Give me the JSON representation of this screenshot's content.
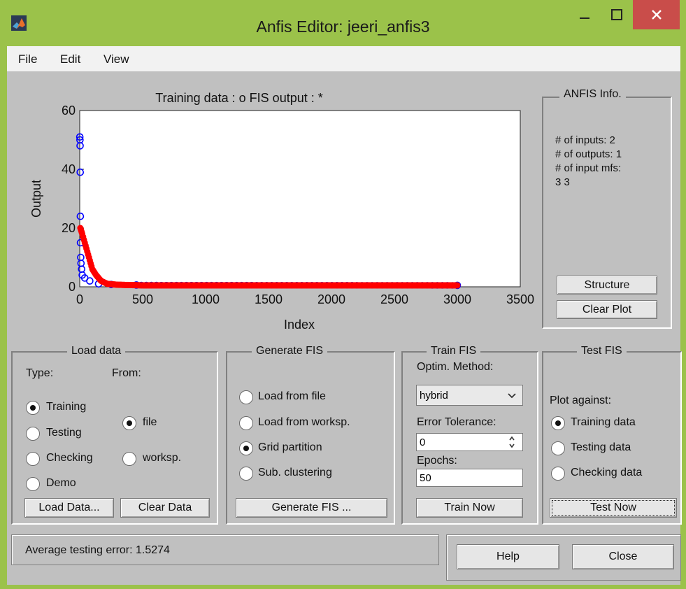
{
  "window": {
    "title": "Anfis Editor: jeeri_anfis3"
  },
  "menu": {
    "file": "File",
    "edit": "Edit",
    "view": "View"
  },
  "plot": {
    "title": "Training data : o   FIS output : *",
    "xlabel": "Index",
    "ylabel": "Output",
    "xticks": [
      "0",
      "500",
      "1000",
      "1500",
      "2000",
      "2500",
      "3000",
      "3500"
    ],
    "yticks": [
      "0",
      "20",
      "40",
      "60"
    ]
  },
  "chart_data": {
    "type": "scatter",
    "title": "Training data : o   FIS output : *",
    "xlabel": "Index",
    "ylabel": "Output",
    "xlim": [
      0,
      3500
    ],
    "ylim": [
      0,
      60
    ],
    "series": [
      {
        "name": "Training data",
        "marker": "o",
        "color": "#0000ff",
        "points": [
          [
            1,
            51
          ],
          [
            2,
            50
          ],
          [
            3,
            48
          ],
          [
            4,
            39
          ],
          [
            5,
            24
          ],
          [
            6,
            15
          ],
          [
            8,
            10
          ],
          [
            10,
            8
          ],
          [
            15,
            6
          ],
          [
            20,
            4
          ],
          [
            40,
            3
          ],
          [
            80,
            2
          ],
          [
            150,
            1
          ],
          [
            250,
            0.8
          ],
          [
            450,
            0.6
          ],
          [
            3000,
            0.5
          ]
        ]
      },
      {
        "name": "FIS output",
        "marker": "*",
        "color": "#ff0000",
        "points": [
          [
            5,
            20
          ],
          [
            20,
            18
          ],
          [
            40,
            15
          ],
          [
            60,
            12
          ],
          [
            80,
            9
          ],
          [
            100,
            6
          ],
          [
            130,
            4
          ],
          [
            170,
            2
          ],
          [
            220,
            1
          ],
          [
            300,
            0.7
          ],
          [
            500,
            0.5
          ],
          [
            3000,
            0.5
          ]
        ]
      }
    ]
  },
  "anfis_info": {
    "title": "ANFIS Info.",
    "inputs": "# of inputs: 2",
    "outputs": "# of outputs: 1",
    "input_mfs": "# of input mfs:",
    "mfs_values": "3  3",
    "structure_button": "Structure",
    "clear_plot_button": "Clear Plot"
  },
  "load_data": {
    "title": "Load data",
    "type_label": "Type:",
    "from_label": "From:",
    "types": [
      "Training",
      "Testing",
      "Checking",
      "Demo"
    ],
    "sources": [
      "file",
      "worksp."
    ],
    "load_button": "Load Data...",
    "clear_button": "Clear Data"
  },
  "generate_fis": {
    "title": "Generate FIS",
    "options": [
      "Load from file",
      "Load from worksp.",
      "Grid partition",
      "Sub. clustering"
    ],
    "button": "Generate FIS ..."
  },
  "train_fis": {
    "title": "Train FIS",
    "optim_label": "Optim. Method:",
    "optim_value": "hybrid",
    "error_label": "Error Tolerance:",
    "error_value": "0",
    "epochs_label": "Epochs:",
    "epochs_value": "50",
    "button": "Train Now"
  },
  "test_fis": {
    "title": "Test FIS",
    "plot_against": "Plot against:",
    "options": [
      "Training data",
      "Testing data",
      "Checking data"
    ],
    "button": "Test Now"
  },
  "status": {
    "text": "Average testing error: 1.5274"
  },
  "footer": {
    "help_button": "Help",
    "close_button": "Close"
  }
}
